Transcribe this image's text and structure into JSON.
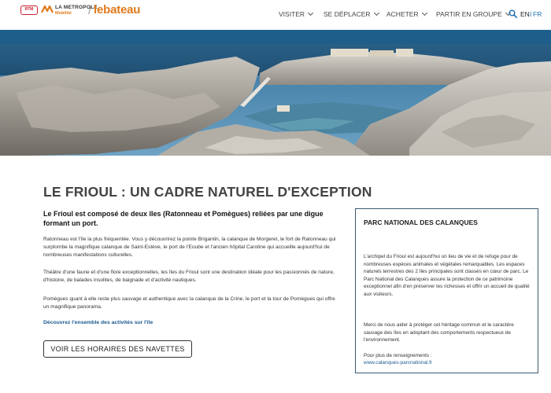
{
  "header": {
    "logo_rtm": "RTM",
    "logo_metropole": "LA METROPOLE",
    "logo_mobilite": "Mobilité",
    "logo_slash": "/",
    "logo_bateau": "lebateau",
    "nav": [
      {
        "label": "VISITER"
      },
      {
        "label": "SE DÉPLACER"
      },
      {
        "label": "ACHETER"
      },
      {
        "label": "PARTIR EN GROUPE"
      }
    ],
    "lang_en": "EN",
    "lang_sep": "I",
    "lang_fr": "FR"
  },
  "main": {
    "title": "LE FRIOUL : UN CADRE NATUREL D'EXCEPTION",
    "intro": "Le Frioul est composé de deux îles (Ratonneau et Pomègues) reliées par une digue formant un port.",
    "paragraph_1": "Ratonneau est l'île la plus fréquentée. Vous y découvrirez la pointe Brigantin, la calanque de Morgeret, le fort de Ratonneau qui surplombe la magnifique calanque de Saint-Estève, le port de l'Eoube et l'ancien hôpital Caroline qui accueille aujourd'hui de nombreuses manifestations culturelles.",
    "paragraph_2": "Théâtre d'une faune et d'une flore exceptionnelles, les îles du Frioul sont une destination idéale pour les passionnés de nature, d'histoire, de balades insolites, de baignade et d'activité nautiques.",
    "paragraph_3": "Pomègues quant à elle reste plus sauvage et authentique avec  la calanque de la Crine, le port et la tour de Pomègues qui offre un magnifique panorama.",
    "discover_link": "Découvrez l'ensemble des activités sur l'île",
    "schedule_button": "VOIR LES HORAIRES DES NAVETTES"
  },
  "side": {
    "title": "PARC NATIONAL DES CALANQUES",
    "paragraph_1": "L'archipel du Frioul est aujourd'hui un lieu de vie et de refuge pour de nombreuses espèces animales et végétales remarquables. Les espaces naturels terrestres des 2  îles principales sont classés en cœur de parc. Le Parc National des Calanques assure la protection de ce patrimoine exceptionnel afin d'en préserver les richesses et offrir un accueil de qualité aux visiteurs.",
    "paragraph_2": "Merci de nous aider à protéger cet héritage commun et le caractère sauvage des îles en adoptant des comportements respectueux de l'environnement.",
    "paragraph_3": "Pour plus de renseignements :",
    "link": "www.calanques-parcnational.fr"
  },
  "icons": {
    "search": "search-icon",
    "chevron": "chevron-down-icon"
  },
  "colors": {
    "accent_orange": "#e07a1b",
    "link_blue": "#1a5a92",
    "box_border": "#3a5a70"
  }
}
